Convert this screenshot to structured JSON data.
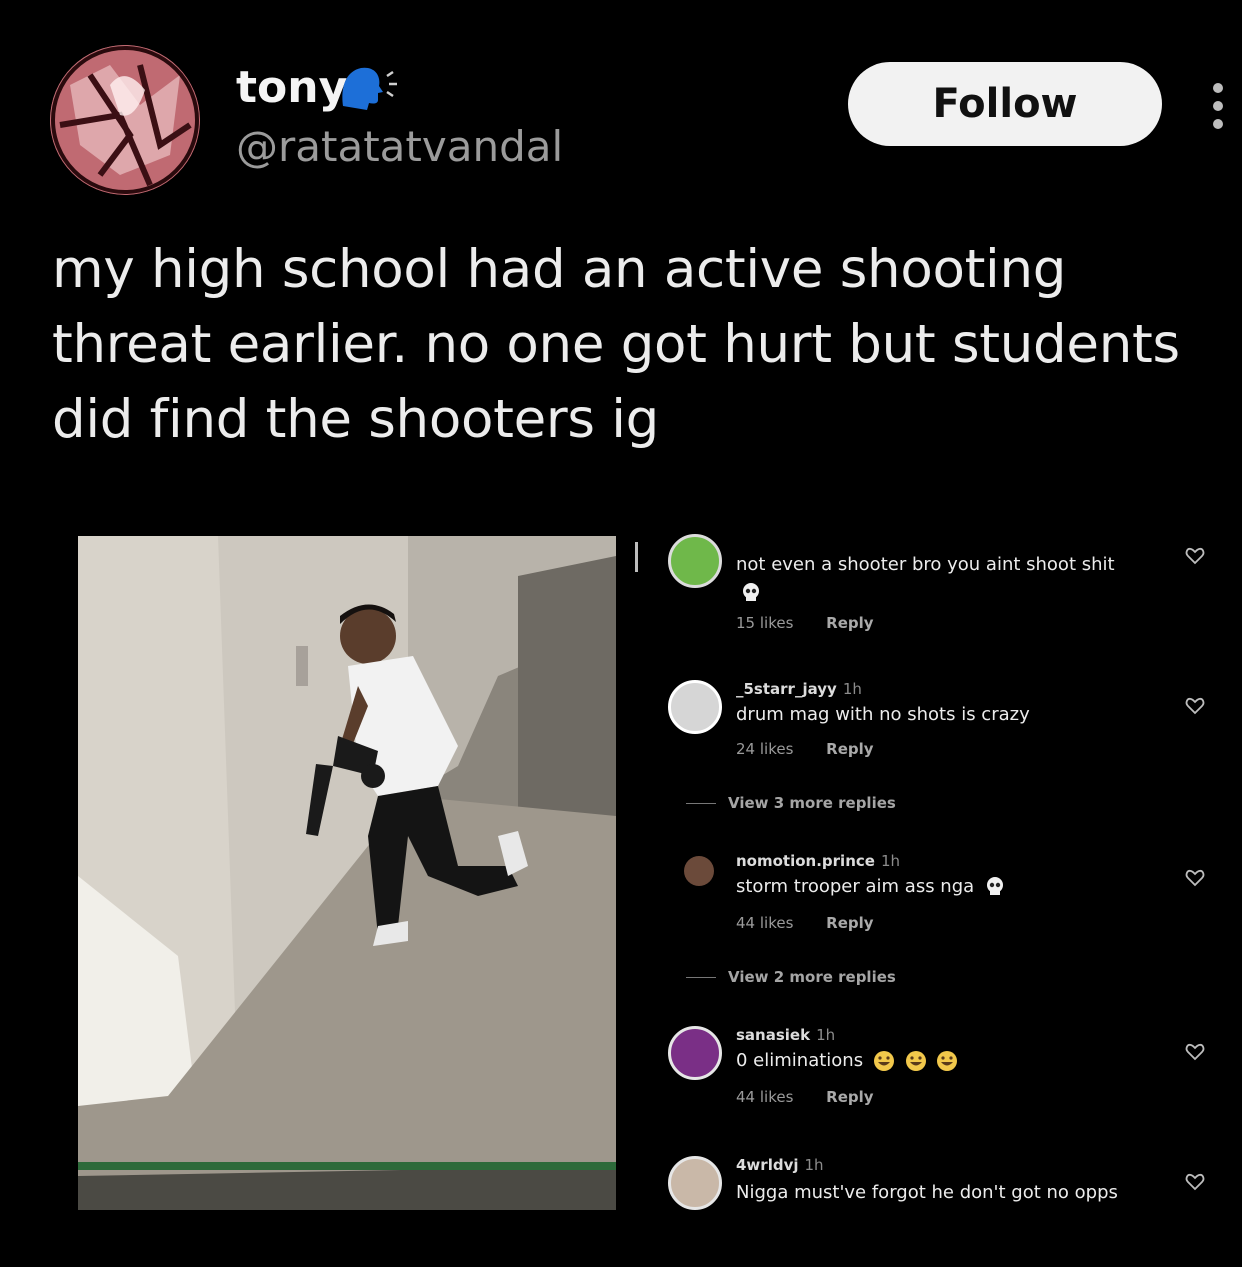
{
  "author": {
    "display_name": "tony",
    "handle": "@ratatatvandal",
    "name_icon": "speaking-head-icon",
    "avatar_icon": "profile-avatar"
  },
  "actions": {
    "follow_label": "Follow",
    "more_icon": "more-vertical-icon"
  },
  "post": {
    "text": "my high school had an active shooting threat earlier. no one got hurt but students did find the shooters ig"
  },
  "media": {
    "photo_icon": "photo-person-holding-gun",
    "comments": [
      {
        "username": "",
        "time": "",
        "text": "not even a shooter bro you aint shoot shit",
        "emoji_icon": "skull-icon",
        "likes": "15 likes",
        "reply": "Reply"
      },
      {
        "username": "_5starr_jayy",
        "time": "1h",
        "text": "drum mag with no shots is crazy",
        "likes": "24 likes",
        "reply": "Reply",
        "view_replies": "View 3 more replies"
      },
      {
        "username": "nomotion.prince",
        "time": "1h",
        "text": "storm trooper aim ass nga",
        "emoji_icon": "skull-icon",
        "likes": "44 likes",
        "reply": "Reply",
        "view_replies": "View 2 more replies"
      },
      {
        "username": "sanasiek",
        "time": "1h",
        "text": "0 eliminations",
        "emoji_icon": "laughing-crying-icon",
        "likes": "44 likes",
        "reply": "Reply"
      },
      {
        "username": "4wrldvj",
        "time": "1h",
        "text": "Nigga must've forgot he don't got no opps"
      }
    ]
  },
  "colors": {
    "background": "#000000",
    "follow_bg": "#f2f2f2",
    "handle": "#9b9b9b",
    "speaker_icon": "#1d6fd8"
  }
}
